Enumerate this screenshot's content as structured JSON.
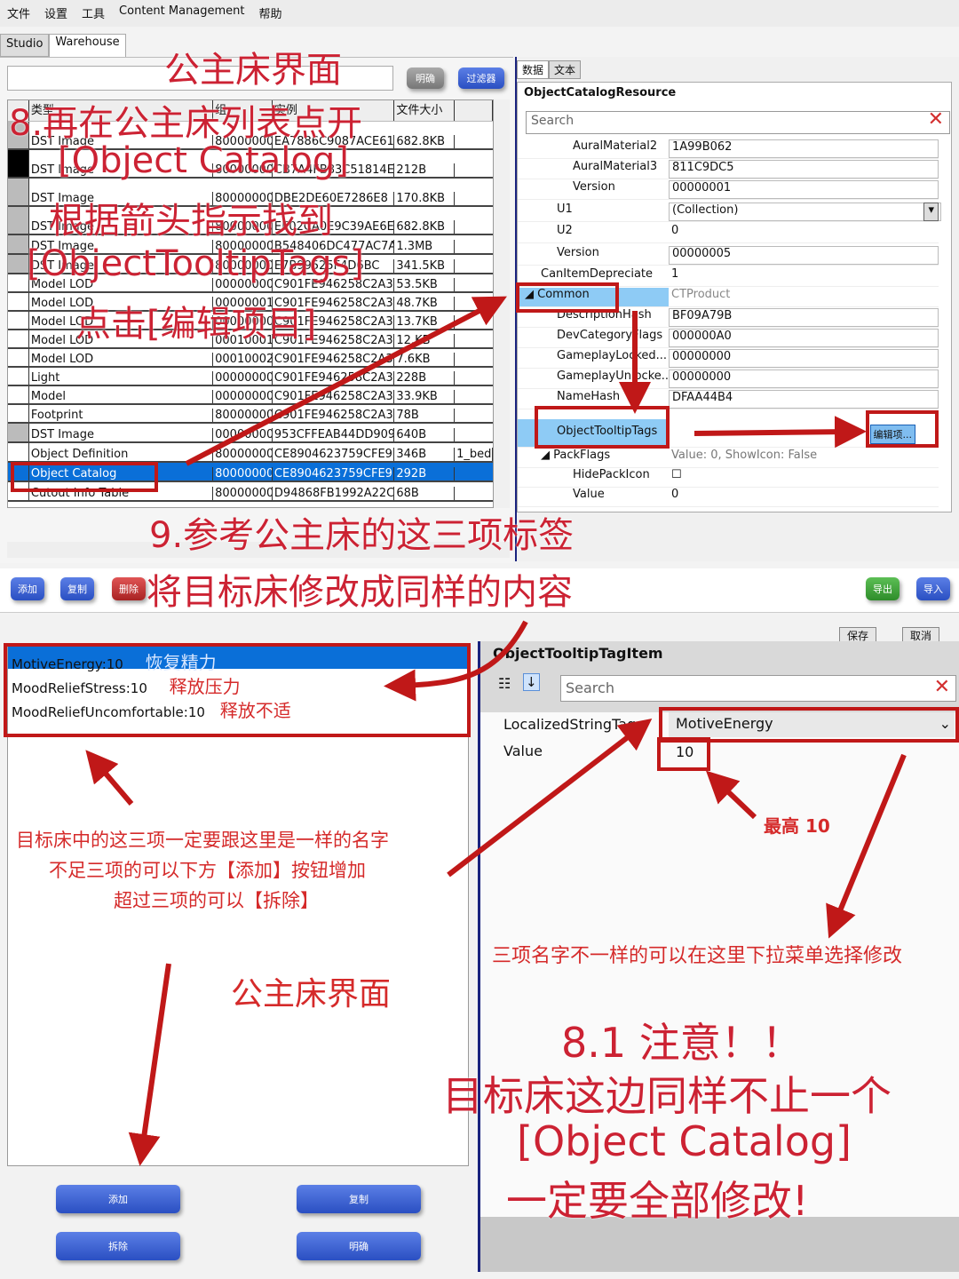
{
  "menu": [
    "文件",
    "设置",
    "工具",
    "Content Management",
    "帮助"
  ],
  "tabs": [
    "Studio",
    "Warehouse"
  ],
  "filter": {
    "clear_label": "明确",
    "filter_label": "过滤器"
  },
  "table": {
    "headers": [
      "类型",
      "组",
      "实例",
      "文件大小",
      ""
    ],
    "rows": [
      [
        "DST Image",
        "80000000",
        "EA7886C9087ACE61",
        "682.8KB",
        ""
      ],
      [
        "DST Image",
        "80000000",
        "CB7A4FB83C51814E",
        "212B",
        ""
      ],
      [
        "DST Image",
        "80000000",
        "DBE2DE60E7286E8",
        "170.8KB",
        ""
      ],
      [
        "DST Image",
        "80000000",
        "EE02CA0E9C39AE6E",
        "682.8KB",
        ""
      ],
      [
        "DST Image",
        "80000000",
        "B548406DC477AC7A",
        "1.3MB",
        ""
      ],
      [
        "DST Image",
        "80000000",
        "E7B99525F4D6BC",
        "341.5KB",
        ""
      ],
      [
        "Model LOD",
        "00000000",
        "C901FE946258C2A3",
        "53.5KB",
        ""
      ],
      [
        "Model LOD",
        "00000001",
        "C901FE946258C2A3",
        "48.7KB",
        ""
      ],
      [
        "Model LOD",
        "00000000",
        "C901FE946258C2A3",
        "13.7KB",
        ""
      ],
      [
        "Model LOD",
        "00010001",
        "C901FE946258C2A3",
        "12.KB",
        ""
      ],
      [
        "Model LOD",
        "00010002",
        "C901FE946258C2A3",
        "7.6KB",
        ""
      ],
      [
        "Light",
        "00000000",
        "C901FE946258C2A3",
        "228B",
        ""
      ],
      [
        "Model",
        "00000000",
        "C901FE946258C2A3",
        "33.9KB",
        ""
      ],
      [
        "Footprint",
        "80000000",
        "C901FE946258C2A3",
        "78B",
        ""
      ],
      [
        "DST Image",
        "00000000",
        "953CFFEAB44DD909",
        "640B",
        ""
      ],
      [
        "Object Definition",
        "80000000",
        "CE8904623759CFE9",
        "346B",
        "1_bed"
      ],
      [
        "Object Catalog",
        "80000000",
        "CE8904623759CFE9",
        "292B",
        ""
      ],
      [
        "Cutout Info Table",
        "80000000",
        "D94868FB1992A22C",
        "68B",
        ""
      ]
    ],
    "selected_row": 16
  },
  "props": {
    "tabs": [
      "数据",
      "文本"
    ],
    "title": "ObjectCatalogResource",
    "search_placeholder": "Search",
    "rows": [
      {
        "label": "AuralMaterial2",
        "value": "1A99B062",
        "indent": 3
      },
      {
        "label": "AuralMaterial3",
        "value": "811C9DC5",
        "indent": 3
      },
      {
        "label": "Version",
        "value": "00000001",
        "indent": 3
      },
      {
        "label": "U1",
        "value": "(Collection)",
        "indent": 2,
        "dropdown": true
      },
      {
        "label": "U2",
        "value": "0",
        "indent": 2,
        "plain": true
      },
      {
        "label": "Version",
        "value": "00000005",
        "indent": 2
      },
      {
        "label": "CanItemDepreciate",
        "value": "1",
        "indent": 1,
        "plain": true
      },
      {
        "label": "◢ Common",
        "value": "CTProduct",
        "indent": 0,
        "category": true
      },
      {
        "label": "DescriptionHash",
        "value": "BF09A79B",
        "indent": 2
      },
      {
        "label": "DevCategoryFlags",
        "value": "000000A0",
        "indent": 2
      },
      {
        "label": "GameplayLocked...",
        "value": "00000000",
        "indent": 2
      },
      {
        "label": "GameplayUnlocke...",
        "value": "00000000",
        "indent": 2
      },
      {
        "label": "NameHash",
        "value": "DFAA44B4",
        "indent": 2
      },
      {
        "label": "ObjectTooltipTags",
        "value": "",
        "indent": 2,
        "edit": "编辑项..."
      },
      {
        "label": "◢ PackFlags",
        "value": "Value: 0, ShowIcon: False",
        "indent": 1,
        "plain": true,
        "gray": true
      },
      {
        "label": "HidePackIcon",
        "value": "☐",
        "indent": 3,
        "plain": true
      },
      {
        "label": "Value",
        "value": "0",
        "indent": 3,
        "plain": true
      }
    ]
  },
  "toolbar": {
    "add": "添加",
    "copy": "复制",
    "delete": "删除",
    "export": "导出",
    "import": "导入"
  },
  "editor": {
    "save": "保存",
    "cancel": "取消",
    "tags": [
      "MotiveEnergy:10",
      "MoodReliefStress:10",
      "MoodReliefUncomfortable:10"
    ],
    "title": "ObjectTooltipTagItem",
    "search_placeholder": "Search",
    "fields": [
      {
        "label": "LocalizedStringTag",
        "value": "MotiveEnergy"
      },
      {
        "label": "Value",
        "value": "10"
      }
    ],
    "buttons": [
      "添加",
      "复制",
      "拆除",
      "明确"
    ]
  },
  "annotations": {
    "a1": "公主床界面",
    "a2": "8.再在公主床列表点开",
    "a3": "[Object Catalog]",
    "a4": "根据箭头指示找到",
    "a5": "[ObjectTooltipTags]",
    "a6": "点击[编辑项目]",
    "a7": "9.参考公主床的这三项标签",
    "a8": "将目标床修改成同样的内容",
    "t1": "恢复精力",
    "t2": "释放压力",
    "t3": "释放不适",
    "n1": "目标床中的这三项一定要跟这里是一样的名字",
    "n2": "不足三项的可以下方【添加】按钮增加",
    "n3": "超过三项的可以【拆除】",
    "n4": "公主床界面",
    "max": "最高 10",
    "dd": "三项名字不一样的可以在这里下拉菜单选择修改",
    "w1": "8.1 注意！！",
    "w2": "目标床这边同样不止一个",
    "w3": "[Object Catalog]",
    "w4": "一定要全部修改!"
  },
  "colors": {
    "annotation": "#cc2233",
    "selection": "#0a6fd8",
    "button_blue": "#2a4fc2"
  }
}
